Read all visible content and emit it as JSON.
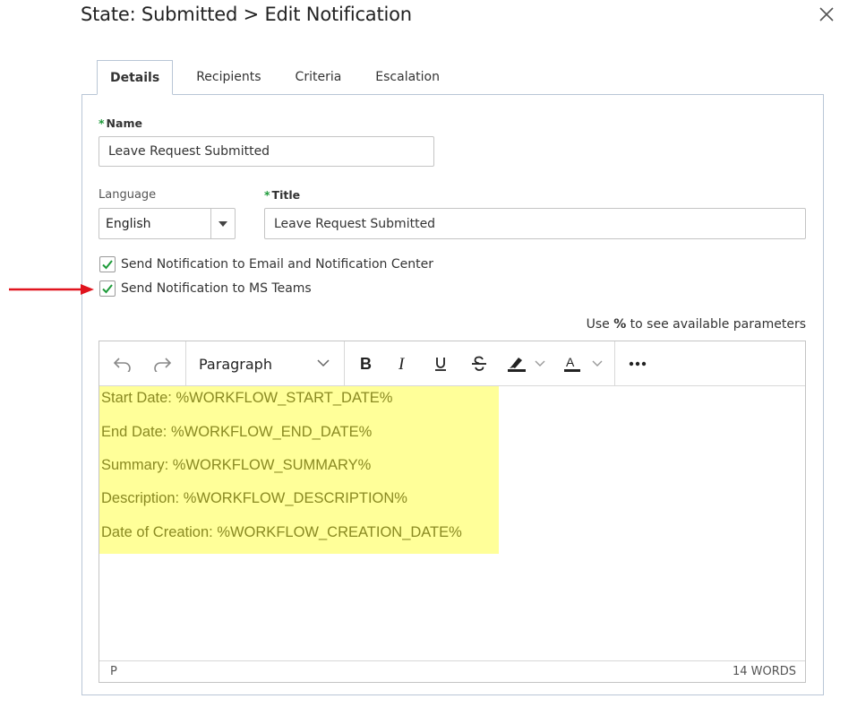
{
  "dialog": {
    "title": "State: Submitted > Edit Notification",
    "close_icon": "close-icon"
  },
  "tabs": [
    {
      "label": "Details",
      "active": true
    },
    {
      "label": "Recipients",
      "active": false
    },
    {
      "label": "Criteria",
      "active": false
    },
    {
      "label": "Escalation",
      "active": false
    }
  ],
  "form": {
    "name": {
      "label": "Name",
      "required": true,
      "value": "Leave Request Submitted"
    },
    "language": {
      "label": "Language",
      "value": "English"
    },
    "title": {
      "label": "Title",
      "required": true,
      "value": "Leave Request Submitted"
    },
    "checkboxes": [
      {
        "label": "Send Notification to Email and Notification Center",
        "checked": true
      },
      {
        "label": "Send Notification to MS Teams",
        "checked": true
      }
    ],
    "params_hint": {
      "prefix": "Use ",
      "symbol": "%",
      "suffix": " to see available parameters"
    }
  },
  "editor": {
    "toolbar": {
      "paragraph_label": "Paragraph",
      "icons": [
        "undo-icon",
        "redo-icon",
        "bold-icon",
        "italic-icon",
        "underline-icon",
        "strikethrough-icon",
        "highlight-icon",
        "font-color-icon",
        "more-icon"
      ]
    },
    "content_lines": [
      "Start Date: %WORKFLOW_START_DATE%",
      "End Date: %WORKFLOW_END_DATE%",
      "Summary: %WORKFLOW_SUMMARY%",
      "Description: %WORKFLOW_DESCRIPTION%",
      "Date of Creation: %WORKFLOW_CREATION_DATE%"
    ],
    "status": {
      "path": "P",
      "word_count": "14 WORDS"
    }
  },
  "colors": {
    "accent_check": "#1e9b3a",
    "highlight": "#ffff99",
    "annotation_arrow": "#e0141e",
    "border": "#b9c6d6"
  }
}
